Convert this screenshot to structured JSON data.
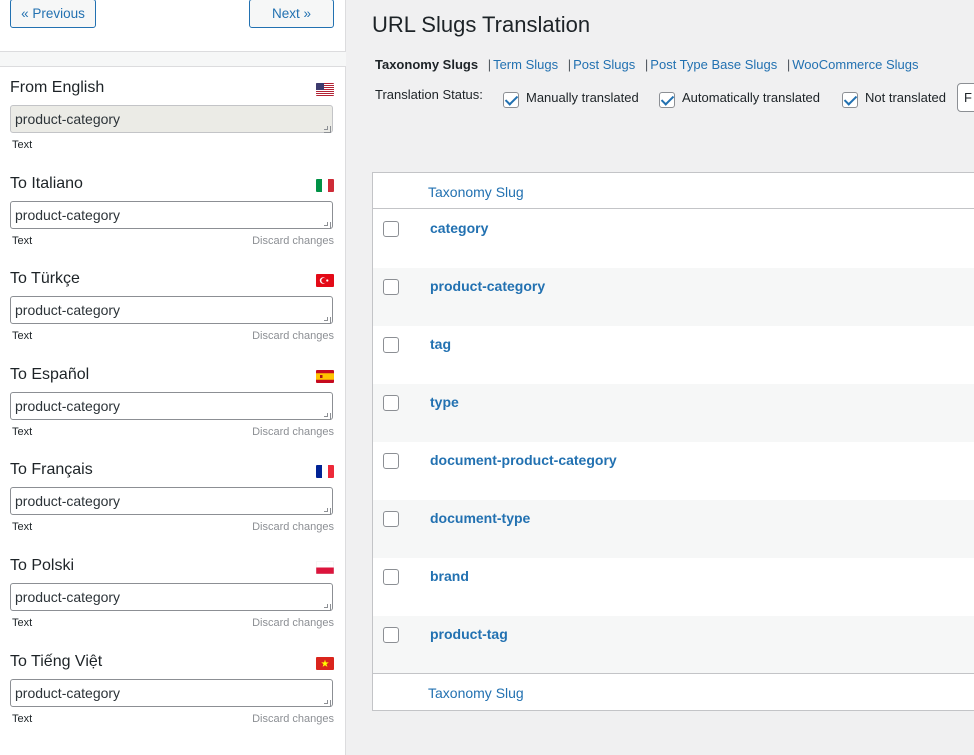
{
  "sidebar": {
    "prev_label": "« Previous",
    "next_label": "Next »",
    "source": {
      "title": "From English",
      "flag": "us-flag",
      "value": "product-category",
      "type_label": "Text"
    },
    "translations": [
      {
        "title": "To Italiano",
        "flag": "it-flag",
        "value": "product-category",
        "type_label": "Text",
        "discard_label": "Discard changes"
      },
      {
        "title": "To Türkçe",
        "flag": "tr-flag",
        "value": "product-category",
        "type_label": "Text",
        "discard_label": "Discard changes"
      },
      {
        "title": "To Español",
        "flag": "es-flag",
        "value": "product-category",
        "type_label": "Text",
        "discard_label": "Discard changes"
      },
      {
        "title": "To Français",
        "flag": "fr-flag",
        "value": "product-category",
        "type_label": "Text",
        "discard_label": "Discard changes"
      },
      {
        "title": "To Polski",
        "flag": "pl-flag",
        "value": "product-category",
        "type_label": "Text",
        "discard_label": "Discard changes"
      },
      {
        "title": "To Tiếng Việt",
        "flag": "vn-flag",
        "value": "product-category",
        "type_label": "Text",
        "discard_label": "Discard changes"
      }
    ]
  },
  "main": {
    "title": "URL Slugs Translation",
    "subnav": {
      "current": "Taxonomy Slugs",
      "links": [
        "Term Slugs",
        "Post Slugs",
        "Post Type Base Slugs",
        "WooCommerce Slugs"
      ]
    },
    "status": {
      "label": "Translation Status:",
      "options": [
        {
          "label": "Manually translated",
          "checked": true
        },
        {
          "label": "Automatically translated",
          "checked": true
        },
        {
          "label": "Not translated",
          "checked": true
        }
      ],
      "filter_stub": "F"
    },
    "table": {
      "column_header": "Taxonomy Slug",
      "rows": [
        "category",
        "product-category",
        "tag",
        "type",
        "document-product-category",
        "document-type",
        "brand",
        "product-tag"
      ]
    }
  },
  "colors": {
    "accent": "#2271b1",
    "text": "#1d2327",
    "muted": "#8c8f94",
    "background": "#f0f0f1"
  }
}
